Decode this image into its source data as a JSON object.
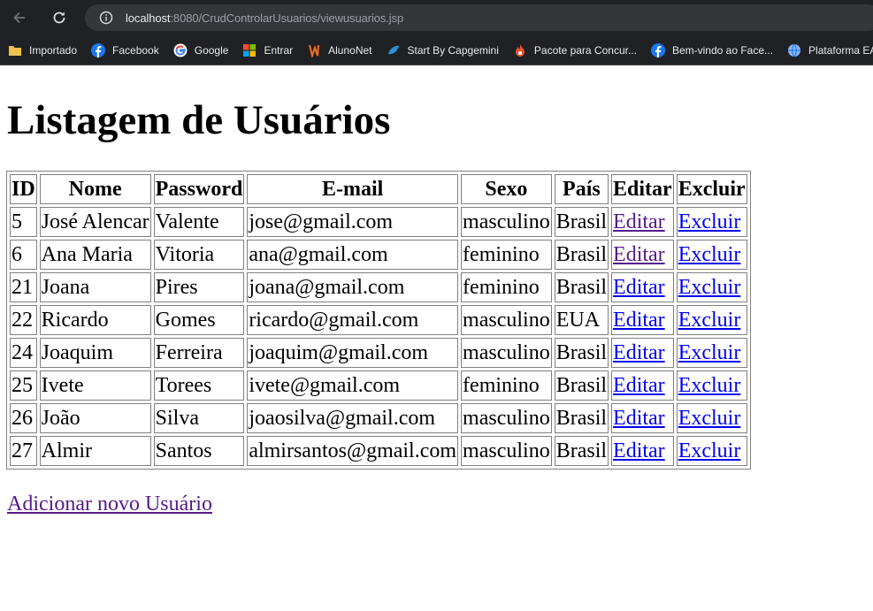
{
  "browser": {
    "url_host": "localhost",
    "url_rest": ":8080/CrudControlarUsuarios/viewusuarios.jsp",
    "bookmarks": [
      {
        "label": "Importado",
        "icon": "folder-icon"
      },
      {
        "label": "Facebook",
        "icon": "facebook-icon"
      },
      {
        "label": "Google",
        "icon": "google-icon"
      },
      {
        "label": "Entrar",
        "icon": "microsoft-icon"
      },
      {
        "label": "AlunoNet",
        "icon": "alunonet-icon"
      },
      {
        "label": "Start By Capgemini",
        "icon": "capgemini-icon"
      },
      {
        "label": "Pacote para Concur...",
        "icon": "flame-icon"
      },
      {
        "label": "Bem-vindo ao Face...",
        "icon": "facebook-icon"
      },
      {
        "label": "Plataforma EAD",
        "icon": "globe-icon"
      }
    ]
  },
  "page": {
    "title": "Listagem de Usuários",
    "add_link": "Adicionar novo Usuário"
  },
  "table": {
    "headers": [
      "ID",
      "Nome",
      "Password",
      "E-mail",
      "Sexo",
      "País",
      "Editar",
      "Excluir"
    ],
    "rows": [
      {
        "id": "5",
        "nome": "José Alencar",
        "password": "Valente",
        "email": "jose@gmail.com",
        "sexo": "masculino",
        "pais": "Brasil",
        "editar": "Editar",
        "excluir": "Excluir"
      },
      {
        "id": "6",
        "nome": "Ana Maria",
        "password": "Vitoria",
        "email": "ana@gmail.com",
        "sexo": "feminino",
        "pais": "Brasil",
        "editar": "Editar",
        "excluir": "Excluir"
      },
      {
        "id": "21",
        "nome": "Joana",
        "password": "Pires",
        "email": "joana@gmail.com",
        "sexo": "feminino",
        "pais": "Brasil",
        "editar": "Editar",
        "excluir": "Excluir"
      },
      {
        "id": "22",
        "nome": "Ricardo",
        "password": "Gomes",
        "email": "ricardo@gmail.com",
        "sexo": "masculino",
        "pais": "EUA",
        "editar": "Editar",
        "excluir": "Excluir"
      },
      {
        "id": "24",
        "nome": "Joaquim",
        "password": "Ferreira",
        "email": "joaquim@gmail.com",
        "sexo": "masculino",
        "pais": "Brasil",
        "editar": "Editar",
        "excluir": "Excluir"
      },
      {
        "id": "25",
        "nome": "Ivete",
        "password": "Torees",
        "email": "ivete@gmail.com",
        "sexo": "feminino",
        "pais": "Brasil",
        "editar": "Editar",
        "excluir": "Excluir"
      },
      {
        "id": "26",
        "nome": "João",
        "password": "Silva",
        "email": "joaosilva@gmail.com",
        "sexo": "masculino",
        "pais": "Brasil",
        "editar": "Editar",
        "excluir": "Excluir"
      },
      {
        "id": "27",
        "nome": "Almir",
        "password": "Santos",
        "email": "almirsantos@gmail.com",
        "sexo": "masculino",
        "pais": "Brasil",
        "editar": "Editar",
        "excluir": "Excluir"
      }
    ]
  },
  "colors": {
    "link": "#0000ee",
    "visited_link": "#551a8b",
    "browser_bg": "#202124",
    "omnibox_bg": "#35363a"
  }
}
